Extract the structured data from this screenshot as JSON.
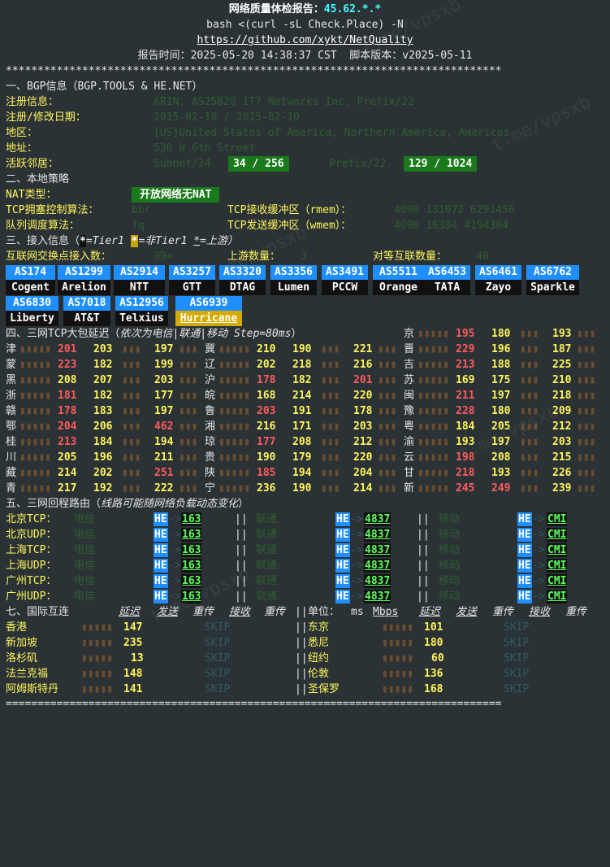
{
  "header": {
    "title_prefix": "网络质量体检报告：",
    "ip": "45.62.*.*",
    "cmd": "bash <(curl -sL Check.Place) -N",
    "url": "https://github.com/xykt/NetQuality",
    "report_time": "报告时间：2025-05-20 14:38:37 CST  脚本版本：v2025-05-11",
    "stars": "******************************************************************************",
    "equals": "=============================================================================="
  },
  "bgp": {
    "heading": "一、BGP信息（BGP.TOOLS & HE.NET）",
    "reg_label": "注册信息：",
    "reg_value": "ARIN, AS25820 IT7 Networks Inc, Prefix/22",
    "date_label": "注册/修改日期：",
    "date_value": "2015-02-10 / 2015-02-10",
    "region_label": "地区：",
    "region_value": "[US]United States of America, Northern America, Americas",
    "addr_label": "地址：",
    "addr_value": "530 W 6th Street",
    "neighbors_label": "活跃邻居：",
    "subnet_label": "Subnet/24",
    "subnet_value": "34 / 256",
    "prefix_label": "Prefix/22",
    "prefix_value": "129 / 1024"
  },
  "local": {
    "heading": "二、本地策略",
    "nat_label": "NAT类型：",
    "nat_value": "开放网络无NAT",
    "tcp_cc_label": "TCP拥塞控制算法：",
    "tcp_cc_value": "bbr",
    "rmem_label": "TCP接收缓冲区（rmem）：",
    "rmem_value": "4096 131072 6291456",
    "qdisc_label": "队列调度算法：",
    "qdisc_value": "fq",
    "wmem_label": "TCP发送缓冲区（wmem）：",
    "wmem_value": "4096 16384 4194304"
  },
  "access": {
    "heading_a": "三、接入信息（",
    "tier1_mark": "*",
    "tier1_text": "=Tier1 ",
    "nontier1_mark": "*",
    "nontier1_text": "=非Tier1 ",
    "upstream_mark": "*",
    "upstream_text": "=上游）",
    "ix_label": "互联网交换点接入数：",
    "ix_value": "99+",
    "upstream_label": "上游数量：",
    "upstream_value": "3",
    "peer_label": "对等互联数量：",
    "peer_value": "40",
    "row1": [
      {
        "as": "AS174",
        "name": "Cogent"
      },
      {
        "as": "AS1299",
        "name": "Arelion"
      },
      {
        "as": "AS2914",
        "name": "NTT"
      },
      {
        "as": "AS3257",
        "name": "GTT"
      },
      {
        "as": "AS3320",
        "name": "DTAG"
      },
      {
        "as": "AS3356",
        "name": "Lumen"
      },
      {
        "as": "AS3491",
        "name": "PCCW"
      },
      {
        "as": "AS5511",
        "name": "Orange"
      },
      {
        "as": "AS6453",
        "name": "TATA"
      },
      {
        "as": "AS6461",
        "name": "Zayo"
      },
      {
        "as": "AS6762",
        "name": "Sparkle"
      }
    ],
    "row2": [
      {
        "as": "AS6830",
        "name": "Liberty"
      },
      {
        "as": "AS7018",
        "name": "AT&T"
      },
      {
        "as": "AS12956",
        "name": "Telxius"
      },
      {
        "as": "AS6939",
        "name": "Hurricane"
      }
    ]
  },
  "latency": {
    "heading": "四、三网TCP大包延迟（",
    "heading_note": "依次为电信|联通|移动 Step=80ms",
    "heading_end": "）",
    "header_cell": {
      "p": "京",
      "v": [
        "195",
        "180",
        "193"
      ],
      "c": [
        "r",
        "y",
        "y"
      ]
    },
    "rows": [
      [
        {
          "p": "津",
          "v": [
            "201",
            "203",
            "197"
          ],
          "c": [
            "r",
            "y",
            "y"
          ]
        },
        {
          "p": "冀",
          "v": [
            "210",
            "190",
            "221"
          ],
          "c": [
            "y",
            "y",
            "y"
          ]
        },
        {
          "p": "晋",
          "v": [
            "229",
            "196",
            "187"
          ],
          "c": [
            "r",
            "y",
            "y"
          ]
        }
      ],
      [
        {
          "p": "蒙",
          "v": [
            "223",
            "182",
            "199"
          ],
          "c": [
            "r",
            "y",
            "y"
          ]
        },
        {
          "p": "辽",
          "v": [
            "202",
            "218",
            "216"
          ],
          "c": [
            "y",
            "y",
            "y"
          ]
        },
        {
          "p": "吉",
          "v": [
            "213",
            "188",
            "225"
          ],
          "c": [
            "r",
            "y",
            "y"
          ]
        }
      ],
      [
        {
          "p": "黑",
          "v": [
            "208",
            "207",
            "203"
          ],
          "c": [
            "y",
            "y",
            "y"
          ]
        },
        {
          "p": "沪",
          "v": [
            "178",
            "182",
            "201"
          ],
          "c": [
            "r",
            "y",
            "r"
          ]
        },
        {
          "p": "苏",
          "v": [
            "169",
            "175",
            "210"
          ],
          "c": [
            "y",
            "y",
            "y"
          ]
        }
      ],
      [
        {
          "p": "浙",
          "v": [
            "181",
            "182",
            "177"
          ],
          "c": [
            "r",
            "y",
            "y"
          ]
        },
        {
          "p": "皖",
          "v": [
            "168",
            "214",
            "220"
          ],
          "c": [
            "y",
            "y",
            "y"
          ]
        },
        {
          "p": "闽",
          "v": [
            "211",
            "197",
            "218"
          ],
          "c": [
            "r",
            "y",
            "y"
          ]
        }
      ],
      [
        {
          "p": "赣",
          "v": [
            "178",
            "183",
            "197"
          ],
          "c": [
            "r",
            "y",
            "y"
          ]
        },
        {
          "p": "鲁",
          "v": [
            "203",
            "191",
            "178"
          ],
          "c": [
            "r",
            "y",
            "y"
          ]
        },
        {
          "p": "豫",
          "v": [
            "228",
            "180",
            "209"
          ],
          "c": [
            "r",
            "y",
            "y"
          ]
        }
      ],
      [
        {
          "p": "鄂",
          "v": [
            "204",
            "206",
            "462"
          ],
          "c": [
            "r",
            "y",
            "r"
          ]
        },
        {
          "p": "湘",
          "v": [
            "216",
            "171",
            "203"
          ],
          "c": [
            "y",
            "y",
            "y"
          ]
        },
        {
          "p": "粤",
          "v": [
            "184",
            "205",
            "212"
          ],
          "c": [
            "y",
            "y",
            "y"
          ]
        }
      ],
      [
        {
          "p": "桂",
          "v": [
            "213",
            "184",
            "194"
          ],
          "c": [
            "r",
            "y",
            "y"
          ]
        },
        {
          "p": "琼",
          "v": [
            "177",
            "208",
            "212"
          ],
          "c": [
            "r",
            "y",
            "y"
          ]
        },
        {
          "p": "渝",
          "v": [
            "193",
            "197",
            "203"
          ],
          "c": [
            "y",
            "y",
            "y"
          ]
        }
      ],
      [
        {
          "p": "川",
          "v": [
            "205",
            "196",
            "211"
          ],
          "c": [
            "y",
            "y",
            "y"
          ]
        },
        {
          "p": "贵",
          "v": [
            "190",
            "179",
            "220"
          ],
          "c": [
            "y",
            "y",
            "y"
          ]
        },
        {
          "p": "云",
          "v": [
            "198",
            "208",
            "215"
          ],
          "c": [
            "r",
            "y",
            "y"
          ]
        }
      ],
      [
        {
          "p": "藏",
          "v": [
            "214",
            "202",
            "251"
          ],
          "c": [
            "y",
            "y",
            "r"
          ]
        },
        {
          "p": "陕",
          "v": [
            "185",
            "194",
            "204"
          ],
          "c": [
            "r",
            "y",
            "y"
          ]
        },
        {
          "p": "甘",
          "v": [
            "218",
            "193",
            "226"
          ],
          "c": [
            "r",
            "y",
            "y"
          ]
        }
      ],
      [
        {
          "p": "青",
          "v": [
            "217",
            "192",
            "222"
          ],
          "c": [
            "y",
            "y",
            "y"
          ]
        },
        {
          "p": "宁",
          "v": [
            "236",
            "190",
            "214"
          ],
          "c": [
            "y",
            "y",
            "y"
          ]
        },
        {
          "p": "新",
          "v": [
            "245",
            "249",
            "239"
          ],
          "c": [
            "r",
            "r",
            "y"
          ]
        }
      ]
    ]
  },
  "routes": {
    "heading": "五、三网回程路由（",
    "heading_note": "线路可能随网络负载动态变化",
    "heading_end": "）",
    "rows": [
      {
        "label": "北京TCP：",
        "n1": "电信",
        "n2": "联通",
        "n3": "移动"
      },
      {
        "label": "北京UDP：",
        "n1": "电信",
        "n2": "联通",
        "n3": "移动"
      },
      {
        "label": "上海TCP：",
        "n1": "电信",
        "n2": "联通",
        "n3": "移动"
      },
      {
        "label": "上海UDP：",
        "n1": "电信",
        "n2": "联通",
        "n3": "移动"
      },
      {
        "label": "广州TCP：",
        "n1": "电信",
        "n2": "联通",
        "n3": "移动"
      },
      {
        "label": "广州UDP：",
        "n1": "电信",
        "n2": "联通",
        "n3": "移动"
      }
    ],
    "he": "HE",
    "arrow": "->",
    "as1": "163",
    "as2": "4837",
    "as3": "CMI",
    "sep": "||"
  },
  "intl": {
    "heading": "七、国际互连",
    "col_latency": "延迟",
    "col_send": "发送",
    "col_resend": "重传",
    "col_recv": "接收",
    "col_resend2": "重传",
    "sep": "||",
    "unit_label": "单位：",
    "unit_ms": "ms",
    "unit_mbps": "Mbps",
    "skip": "SKIP",
    "rows": [
      {
        "l": {
          "city": "香港",
          "lat": "147"
        },
        "r": {
          "city": "东京",
          "lat": "101"
        }
      },
      {
        "l": {
          "city": "新加坡",
          "lat": "235"
        },
        "r": {
          "city": "悉尼",
          "lat": "180"
        }
      },
      {
        "l": {
          "city": "洛杉矶",
          "lat": "13"
        },
        "r": {
          "city": "纽约",
          "lat": "60"
        }
      },
      {
        "l": {
          "city": "法兰克福",
          "lat": "148"
        },
        "r": {
          "city": "伦敦",
          "lat": "136"
        }
      },
      {
        "l": {
          "city": "阿姆斯特丹",
          "lat": "141"
        },
        "r": {
          "city": "圣保罗",
          "lat": "168"
        }
      }
    ]
  },
  "watermark": "t.me/vpsxb",
  "colors": {
    "background": "#2b3236",
    "yellow": "#fff55a",
    "red": "#ff5b5b",
    "green_bg": "#19791b",
    "as_blue": "#1f8fff",
    "hurricane_bg": "#d4aa00"
  }
}
